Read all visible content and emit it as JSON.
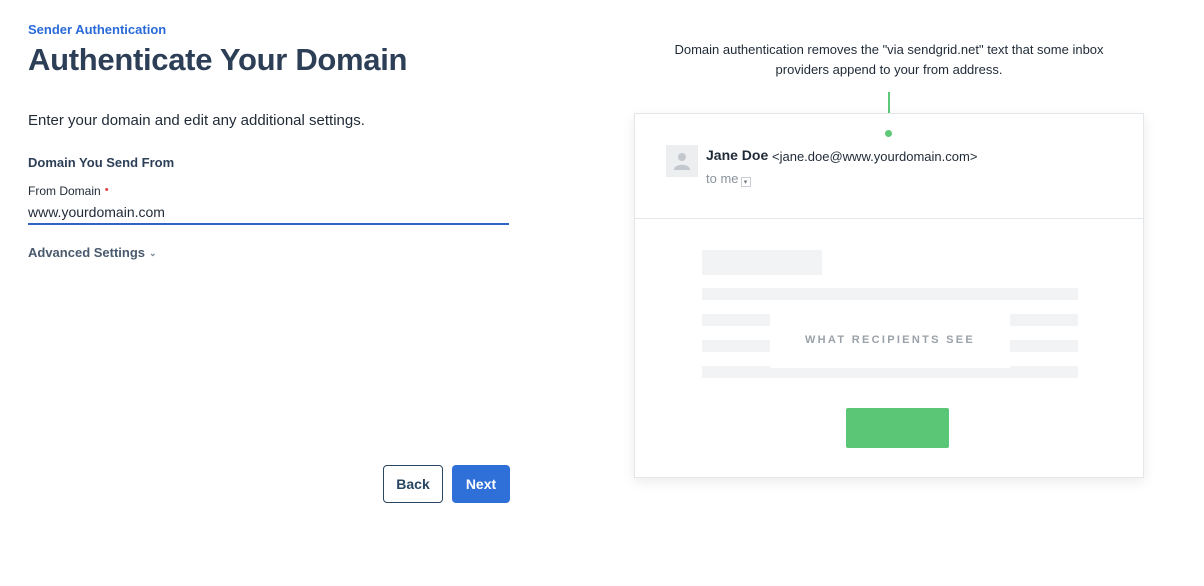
{
  "header": {
    "breadcrumb": "Sender Authentication",
    "title": "Authenticate Your Domain"
  },
  "form": {
    "intro": "Enter your domain and edit any additional settings.",
    "section_title": "Domain You Send From",
    "from_domain_label": "From Domain",
    "required_marker": "•",
    "from_domain_value": "www.yourdomain.com",
    "advanced_settings": "Advanced Settings",
    "advanced_chevron": "⌄"
  },
  "actions": {
    "back_label": "Back",
    "next_label": "Next"
  },
  "preview": {
    "caption": "Domain authentication removes the \"via sendgrid.net\" text that some inbox providers append to your from address.",
    "sender_name": "Jane Doe",
    "sender_email": "<jane.doe@www.yourdomain.com>",
    "to_me": "to me",
    "to_me_chevron": "▾",
    "overlay": "WHAT RECIPIENTS SEE"
  },
  "colors": {
    "accent": "#2f6fd8",
    "callout": "#5dc878",
    "cta": "#5cc677",
    "required": "#e03b3b"
  },
  "icons": {
    "avatar": "person-silhouette-icon"
  }
}
